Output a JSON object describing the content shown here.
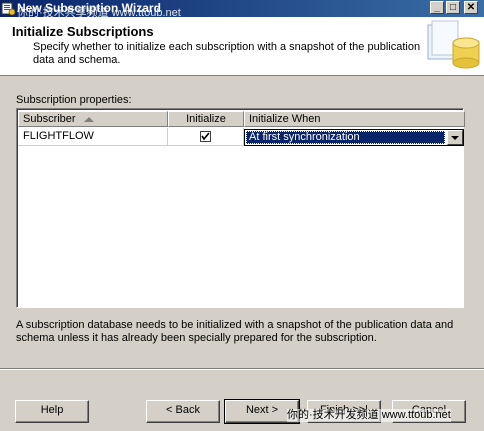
{
  "window": {
    "title": "New Subscription Wizard",
    "watermark_top": "你的·技术共享频道 www.ttoub.net",
    "controls": {
      "minimize": "_",
      "maximize": "□",
      "close": "✕"
    }
  },
  "header": {
    "title": "Initialize Subscriptions",
    "description": "Specify whether to initialize each subscription with a snapshot of the publication data and schema."
  },
  "grid": {
    "label": "Subscription properties:",
    "columns": [
      "Subscriber",
      "Initialize",
      "Initialize When"
    ],
    "rows": [
      {
        "subscriber": "FLIGHTFLOW",
        "initialize": true,
        "initialize_when": "At first synchronization"
      }
    ]
  },
  "info": "A subscription database needs to be initialized with a snapshot of the publication data and schema unless it has already been specially prepared for the subscription.",
  "buttons": {
    "help": "Help",
    "back": "< Back",
    "next": "Next >",
    "finish": "Finish >>|",
    "cancel": "Cancel"
  },
  "watermark_bottom": "你的·技术开发频道 www.ttoub.net",
  "colors": {
    "selection": "#0a246a",
    "face": "#d4d0c8",
    "titlebar": "#0a246a"
  }
}
